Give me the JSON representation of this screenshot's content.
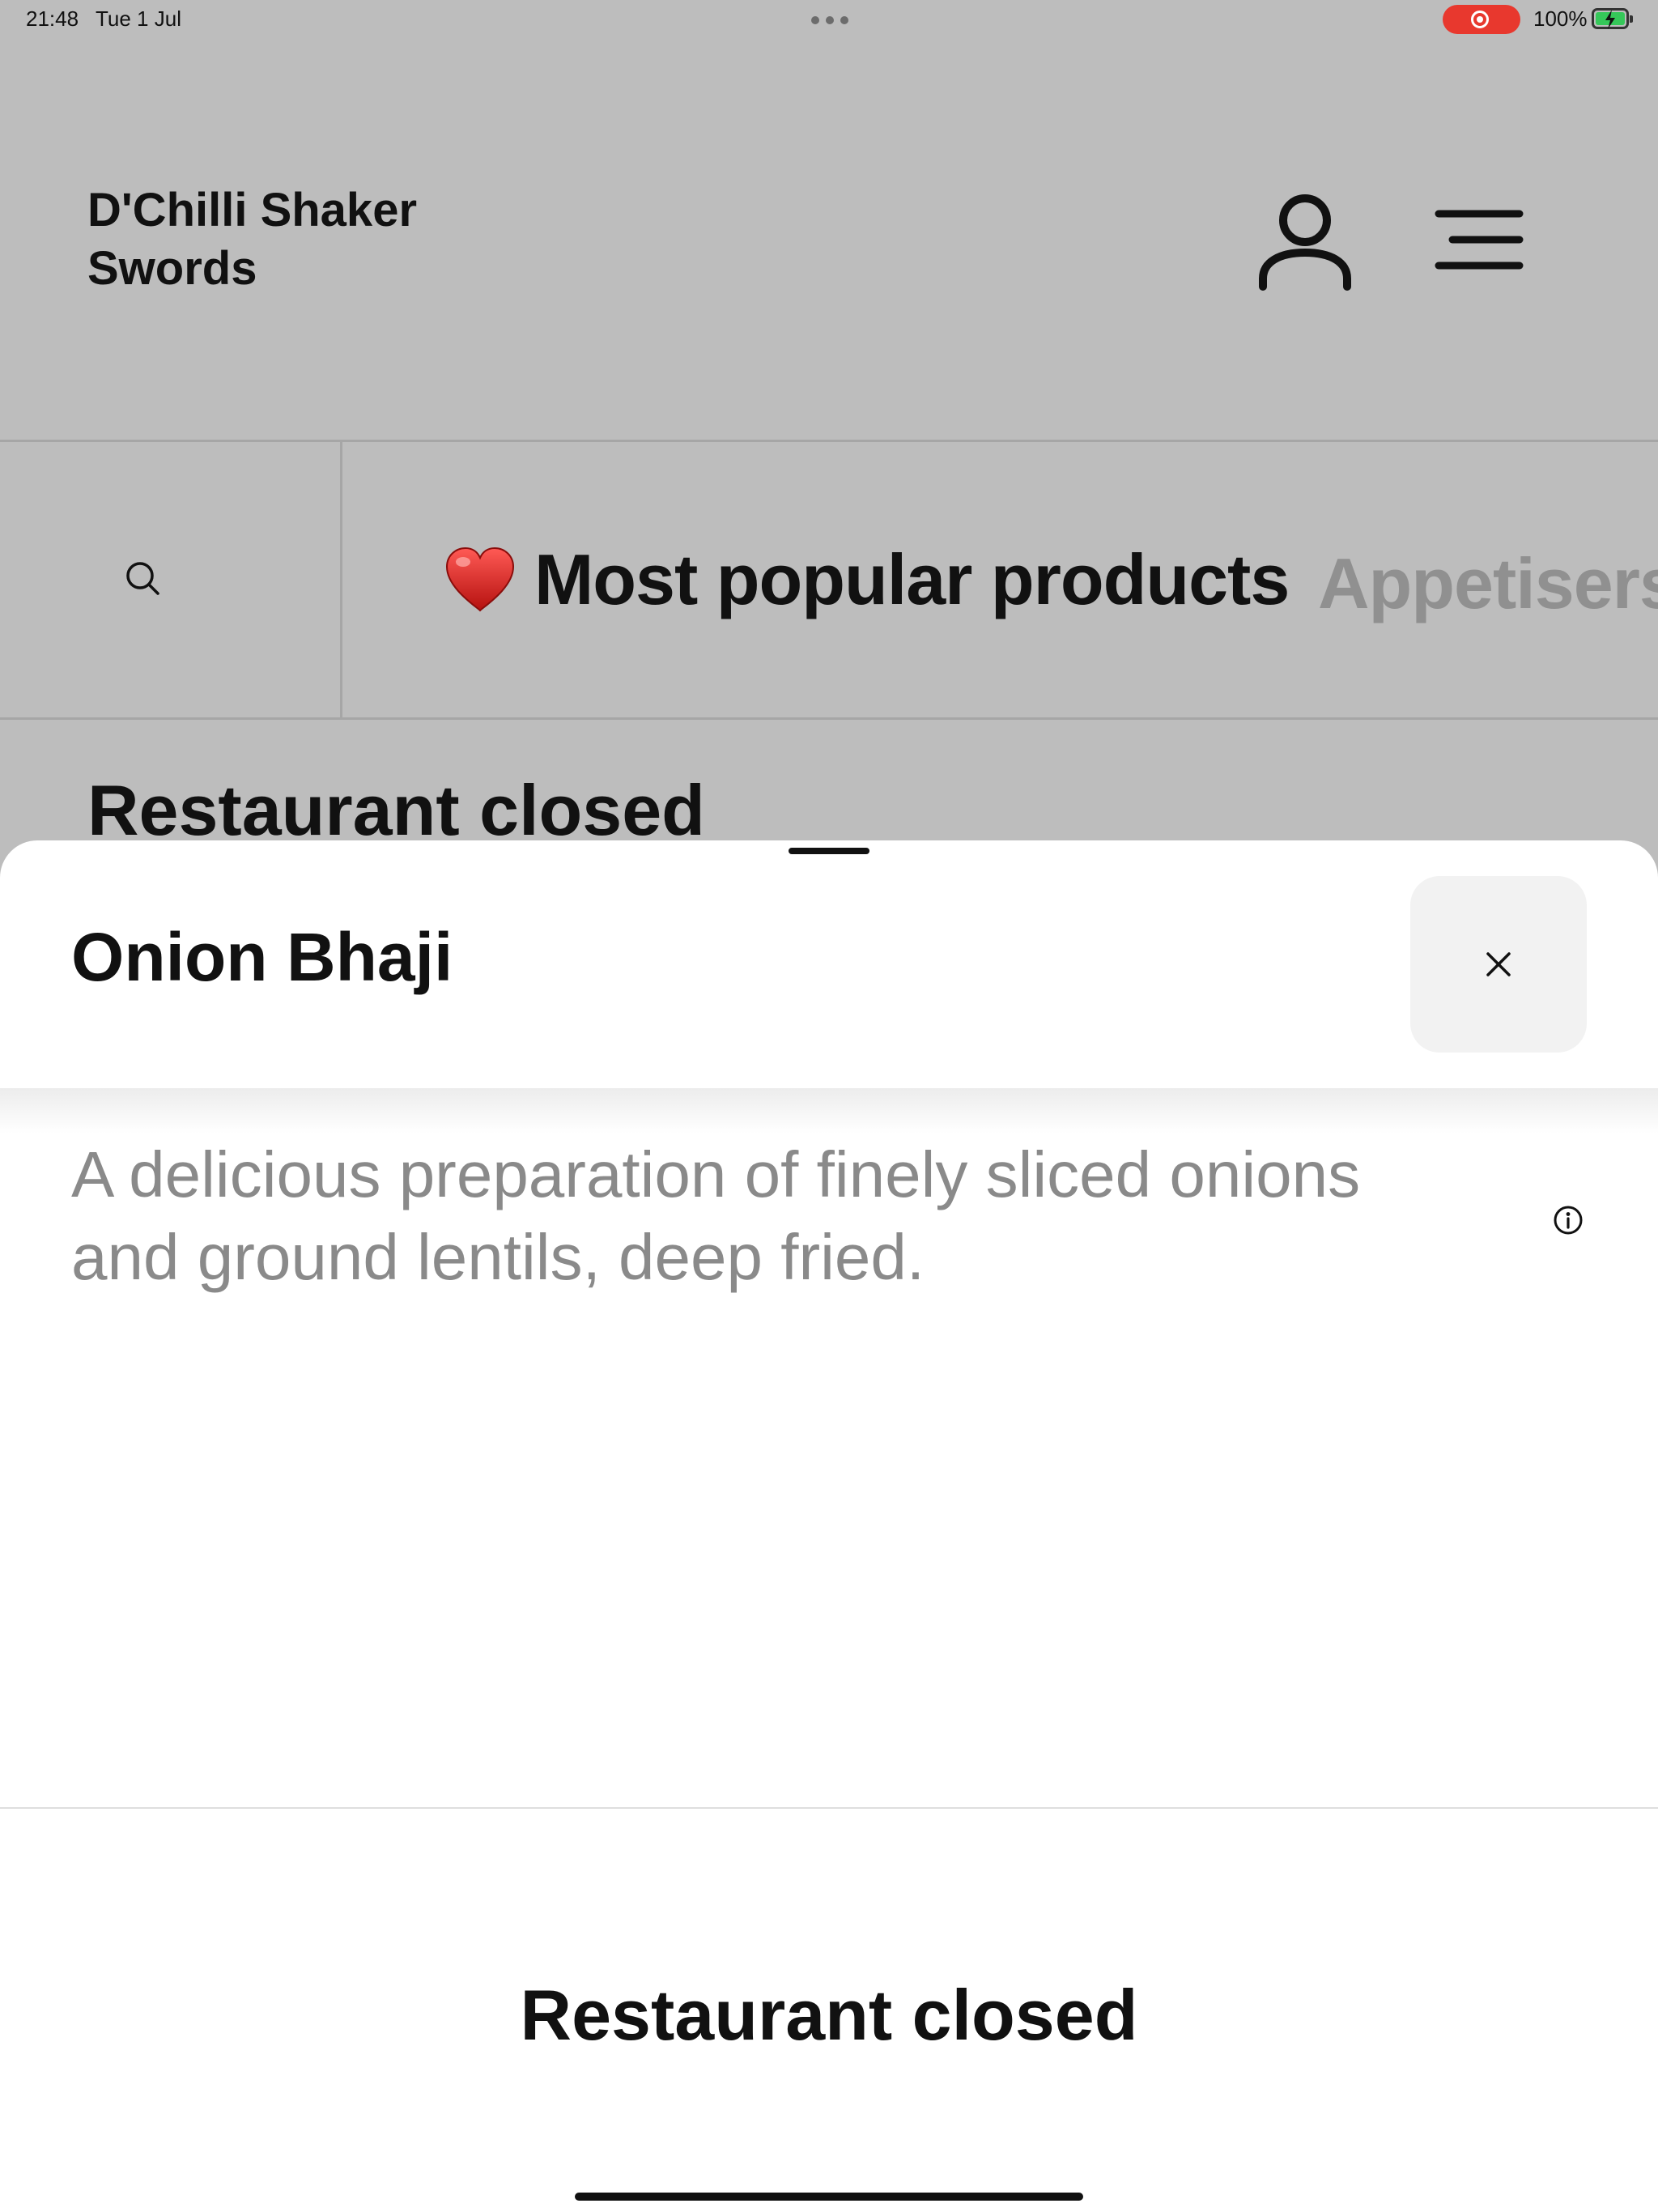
{
  "status_bar": {
    "time": "21:48",
    "date": "Tue 1 Jul",
    "battery_percent": "100%",
    "battery_level": 1.0,
    "recording_color": "#e8382e",
    "battery_color": "#35c759"
  },
  "header": {
    "store_name": "D'Chilli Shaker Swords",
    "account_icon": "person-icon",
    "menu_icon": "hamburger-menu-icon"
  },
  "categories": {
    "search_icon": "search-icon",
    "active": {
      "emoji_icon": "red-heart-icon",
      "label": "Most popular products"
    },
    "next": {
      "label": "Appetisers"
    }
  },
  "background_notice": "Restaurant closed",
  "product_sheet": {
    "title": "Onion Bhaji",
    "description": "A delicious preparation of finely sliced onions and ground lentils, deep fried.",
    "close_icon": "close-icon",
    "info_icon": "info-icon",
    "footer_status": "Restaurant closed"
  },
  "colors": {
    "backdrop": "#bdbdbd",
    "sheet": "#ffffff",
    "muted_text": "#8a8a8a",
    "inactive_tab": "#909090"
  }
}
